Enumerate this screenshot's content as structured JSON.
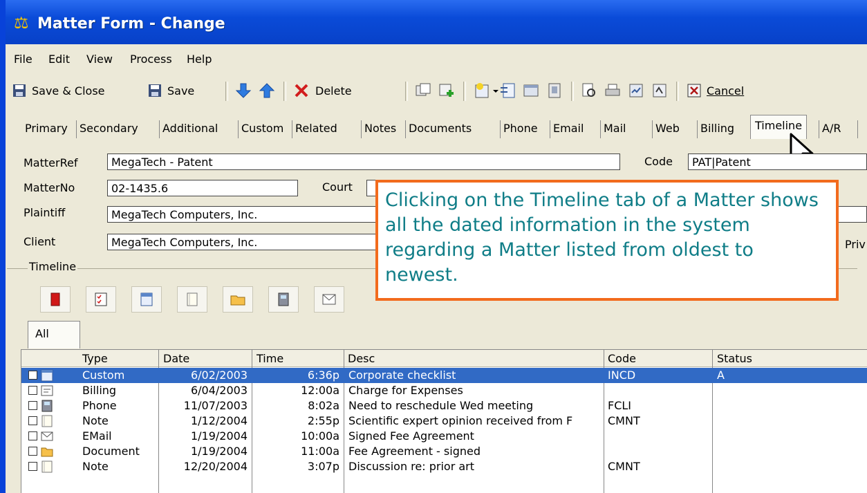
{
  "window": {
    "title": "Matter Form - Change",
    "title_icon": "scales-icon"
  },
  "menu": [
    "File",
    "Edit",
    "View",
    "Process",
    "Help"
  ],
  "toolbar": {
    "save_close": "Save & Close",
    "save": "Save",
    "delete": "Delete",
    "cancel": "Cancel"
  },
  "tabs": [
    "Primary",
    "Secondary",
    "Additional",
    "Custom",
    "Related",
    "Notes",
    "Documents",
    "Phone",
    "Email",
    "Mail",
    "Web",
    "Billing",
    "Timeline",
    "A/R"
  ],
  "active_tab": "Timeline",
  "form": {
    "matterref_label": "MatterRef",
    "matterref_value": "MegaTech - Patent",
    "code_label": "Code",
    "code_value": "PAT|Patent",
    "matterno_label": "MatterNo",
    "matterno_value": "02-1435.6",
    "court_label": "Court",
    "plaintiff_label": "Plaintiff",
    "plaintiff_value": "MegaTech Computers, Inc.",
    "client_label": "Client",
    "client_value": "MegaTech Computers, Inc.",
    "priv_label": "Priv"
  },
  "timeline": {
    "group_label": "Timeline",
    "subtab": "All",
    "columns": [
      "Type",
      "Date",
      "Time",
      "Desc",
      "Code",
      "Status"
    ],
    "rows": [
      {
        "type": "Custom",
        "date": "6/02/2003",
        "time": "6:36p",
        "desc": "Corporate checklist",
        "code": "INCD",
        "status": "A"
      },
      {
        "type": "Billing",
        "date": "6/04/2003",
        "time": "12:00a",
        "desc": "Charge for Expenses",
        "code": "",
        "status": ""
      },
      {
        "type": "Phone",
        "date": "11/07/2003",
        "time": "8:02a",
        "desc": "Need to reschedule Wed meeting",
        "code": "FCLI",
        "status": ""
      },
      {
        "type": "Note",
        "date": "1/12/2004",
        "time": "2:55p",
        "desc": "Scientific expert opinion received from F",
        "code": "CMNT",
        "status": ""
      },
      {
        "type": "EMail",
        "date": "1/19/2004",
        "time": "10:00a",
        "desc": "Signed Fee Agreement",
        "code": "",
        "status": ""
      },
      {
        "type": "Document",
        "date": "1/19/2004",
        "time": "11:00a",
        "desc": "Fee Agreement - signed",
        "code": "",
        "status": ""
      },
      {
        "type": "Note",
        "date": "12/20/2004",
        "time": "3:07p",
        "desc": "Discussion re: prior art",
        "code": "CMNT",
        "status": ""
      }
    ]
  },
  "callout": "Clicking on the Timeline tab of a Matter shows all the dated information in the system regarding a Matter listed from oldest to newest.",
  "colors": {
    "title_blue": "#0a4bd8",
    "selection": "#316ac5",
    "callout_border": "#f26b1d",
    "callout_text": "#0f7d87"
  }
}
